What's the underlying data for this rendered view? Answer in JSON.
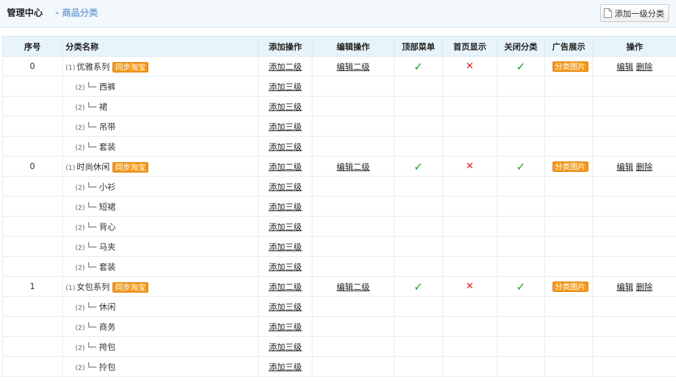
{
  "header": {
    "title": "管理中心",
    "subtitle": "- 商品分类",
    "add_top_label": "添加一级分类"
  },
  "columns": [
    "序号",
    "分类名称",
    "添加操作",
    "编辑操作",
    "顶部菜单",
    "首页显示",
    "关闭分类",
    "广告展示",
    "操作"
  ],
  "labels": {
    "add_level2": "添加二级",
    "add_level3": "添加三级",
    "edit_level2": "编辑二级",
    "sync_taobao": "同步淘宝",
    "category_image": "分类图片",
    "edit": "编辑",
    "delete": "删除",
    "level1_marker": "(1)",
    "level2_marker": "(2)",
    "branch": "└─",
    "check": "✓",
    "cross": "✕"
  },
  "colors": {
    "accent": "#f39a1c",
    "check": "#1f9c2b",
    "cross": "#dd1f1f",
    "header_bg": "#e8f4fc"
  },
  "categories": [
    {
      "order": "0",
      "name": "优雅系列",
      "top_menu": true,
      "home_show": false,
      "closed": true,
      "children": [
        "西裤",
        "裙",
        "吊带",
        "套装"
      ]
    },
    {
      "order": "0",
      "name": "时尚休闲",
      "top_menu": true,
      "home_show": false,
      "closed": true,
      "children": [
        "小衫",
        "短裙",
        "背心",
        "马夹",
        "套装"
      ]
    },
    {
      "order": "1",
      "name": "女包系列",
      "top_menu": true,
      "home_show": false,
      "closed": true,
      "children": [
        "休闲",
        "商务",
        "挎包",
        "拎包"
      ]
    }
  ]
}
